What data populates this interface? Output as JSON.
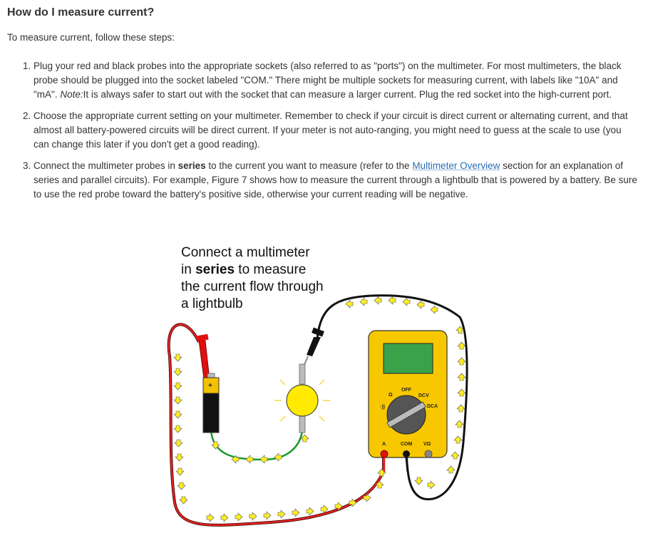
{
  "heading": "How do I measure current?",
  "intro": "To measure current, follow these steps:",
  "steps": [
    {
      "a": "Plug your red and black probes into the appropriate sockets (also referred to as \"ports\") on the multimeter. For most multimeters, the black probe should be plugged into the socket labeled \"COM.\" There might be multiple sockets for measuring current, with labels like \"10A\" and \"mA\". ",
      "note_label": "Note:",
      "b": "It is always safer to start out with the socket that can measure a larger current. Plug the red socket into the high-current port."
    },
    {
      "text": "Choose the appropriate current setting on your multimeter. Remember to check if your circuit is direct current or alternating current, and that almost all battery-powered circuits will be direct current. If your meter is not auto-ranging, you might need to guess at the scale to use (you can change this later if you don't get a good reading)."
    },
    {
      "a": "Connect the multimeter probes in ",
      "bold": "series",
      "b": " to the current you want to measure (refer to the ",
      "link": "Multimeter Overview",
      "c": " section for an explanation of series and parallel circuits). For example, Figure 7 shows how to measure the current through a lightbulb that is powered by a battery. Be sure to use the red probe toward the battery's positive side, otherwise your current reading will be negative."
    }
  ],
  "figure": {
    "caption_line1": "Connect a multimeter",
    "caption_line2_pre": "in ",
    "caption_line2_bold": "series",
    "caption_line2_post": " to measure",
    "caption_line3": "the current flow through",
    "caption_line4": "a lightbulb",
    "battery_plus": "+",
    "meter": {
      "off": "OFF",
      "dcv": "DCV",
      "dca": "DCA",
      "ohm": "Ω",
      "sound": "·))",
      "port_a": "A",
      "port_com": "COM",
      "port_vohm": "VΩ"
    },
    "colors": {
      "meter_body": "#f7c800",
      "display": "#3aa24a",
      "red_wire": "#e32222",
      "black_wire": "#111111",
      "green_wire": "#1c9a2c",
      "bulb": "#ffea00",
      "arrow": "#ffee22"
    }
  }
}
